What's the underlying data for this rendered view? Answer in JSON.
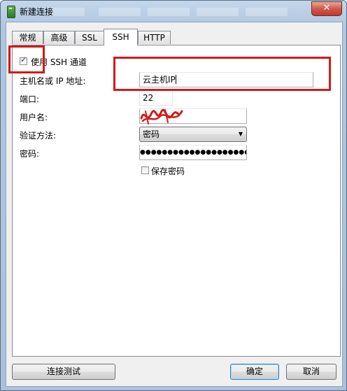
{
  "window": {
    "title": "新建连接",
    "close_glyph": "✕",
    "icon": "app-icon"
  },
  "tabs": [
    {
      "label": "常规"
    },
    {
      "label": "高级"
    },
    {
      "label": "SSL"
    },
    {
      "label": "SSH",
      "active": true
    },
    {
      "label": "HTTP"
    }
  ],
  "ssh": {
    "use_ssh_label": "使用 SSH 通道",
    "use_ssh_checked": true,
    "host_label": "主机名或 IP 地址:",
    "host_value": "云主机IP",
    "port_label": "端口:",
    "port_value": "22",
    "username_label": "用户名:",
    "username_value": "",
    "auth_label": "验证方法:",
    "auth_value": "密码",
    "password_label": "密码:",
    "password_value": "●●●●●●●●●●●●●●●●●●●●●●●●",
    "save_password_label": "保存密码",
    "save_password_checked": false
  },
  "buttons": {
    "test": "连接测试",
    "ok": "确定",
    "cancel": "取消"
  },
  "colors": {
    "annotation_red": "#d11a1a",
    "window_frame": "#aec6e0"
  }
}
